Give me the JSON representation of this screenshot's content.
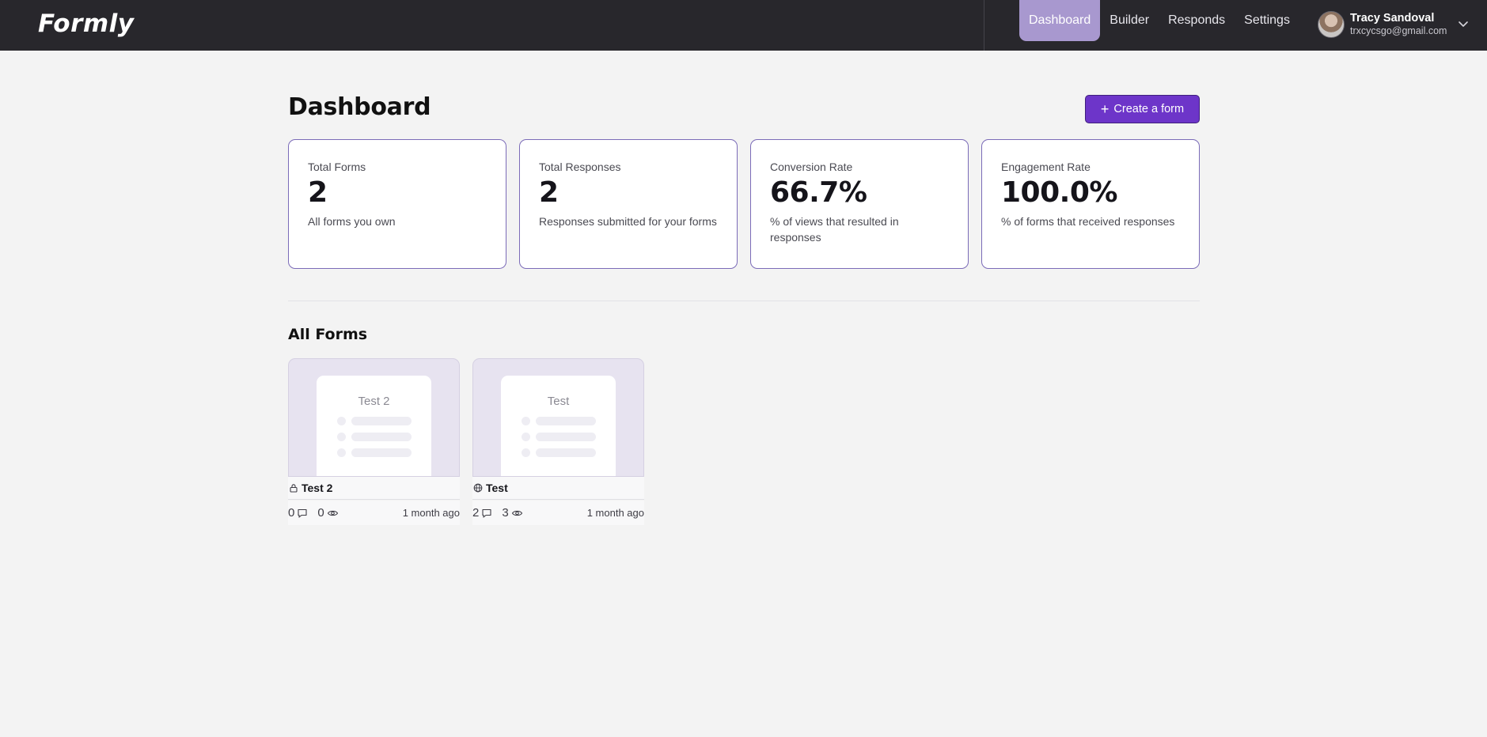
{
  "app": {
    "name": "Formly"
  },
  "nav": {
    "items": [
      {
        "label": "Dashboard",
        "active": true
      },
      {
        "label": "Builder",
        "active": false
      },
      {
        "label": "Responds",
        "active": false
      },
      {
        "label": "Settings",
        "active": false
      }
    ]
  },
  "user": {
    "name": "Tracy Sandoval",
    "email": "trxcycsgo@gmail.com"
  },
  "page": {
    "title": "Dashboard",
    "create_button": "Create a form"
  },
  "stats": [
    {
      "title": "Total Forms",
      "value": "2",
      "desc": "All forms you own"
    },
    {
      "title": "Total Responses",
      "value": "2",
      "desc": "Responses submitted for your forms"
    },
    {
      "title": "Conversion Rate",
      "value": "66.7%",
      "desc": "% of views that resulted in responses"
    },
    {
      "title": "Engagement Rate",
      "value": "100.0%",
      "desc": "% of forms that received responses"
    }
  ],
  "forms_section": {
    "title": "All Forms",
    "forms": [
      {
        "preview_title": "Test 2",
        "name": "Test 2",
        "visibility_icon": "lock-icon",
        "responses": "0",
        "views": "0",
        "updated": "1 month ago"
      },
      {
        "preview_title": "Test",
        "name": "Test",
        "visibility_icon": "globe-icon",
        "responses": "2",
        "views": "3",
        "updated": "1 month ago"
      }
    ]
  },
  "colors": {
    "topbar": "#28272c",
    "accent": "#6d35c9",
    "nav_active": "#a898cf",
    "card_border": "#7b6bb8"
  }
}
